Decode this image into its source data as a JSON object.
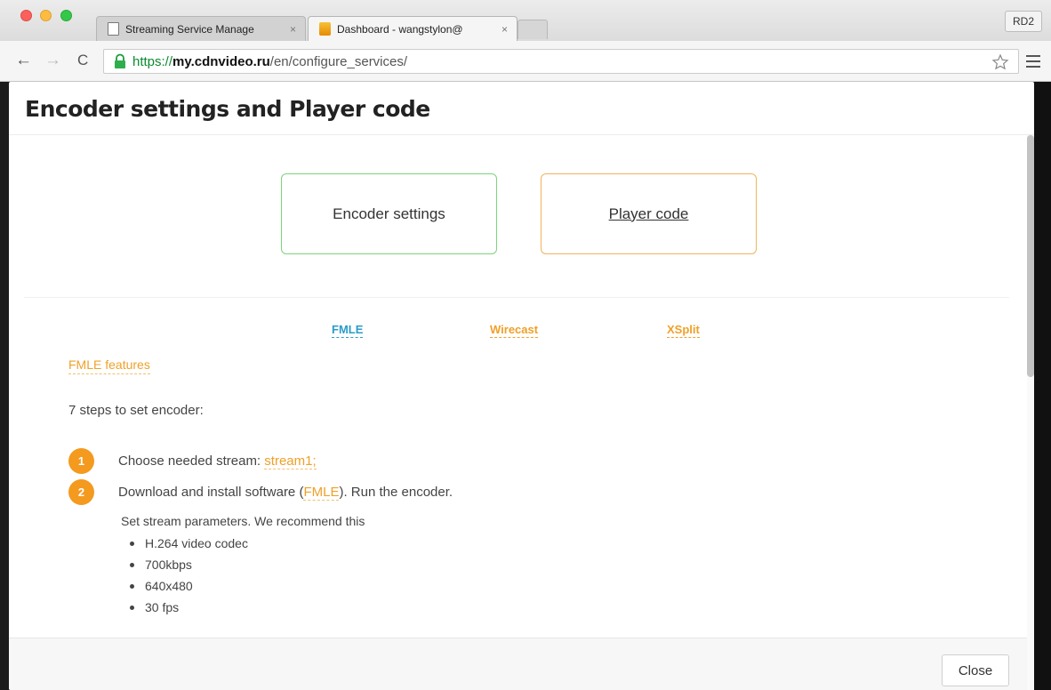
{
  "browser": {
    "tabs": [
      {
        "title": "Streaming Service Manage",
        "close": "×"
      },
      {
        "title": "Dashboard - wangstylon@",
        "close": "×"
      }
    ],
    "profile": "RD2",
    "url": {
      "scheme": "https://",
      "host": "my.cdnvideo.ru",
      "path": "/en/configure_services/"
    }
  },
  "modal": {
    "title": "Encoder settings and Player code",
    "cards": {
      "encoder": "Encoder settings",
      "player": "Player code"
    },
    "encoder_tabs": [
      "FMLE",
      "Wirecast",
      "XSplit"
    ],
    "features_link": "FMLE features",
    "steps_heading": "7 steps to set encoder:",
    "step1": {
      "num": "1",
      "text": "Choose needed stream: ",
      "link": "stream1;"
    },
    "step2": {
      "num": "2",
      "text_before": "Download and install software (",
      "link": "FMLE",
      "text_after": "). Run the encoder."
    },
    "params_intro": "Set stream parameters. We recommend this",
    "params": [
      "H.264 video codec",
      "700kbps",
      "640x480",
      "30 fps"
    ],
    "close_label": "Close"
  },
  "colors": {
    "accent_orange": "#f0a028",
    "accent_blue": "#2b9cc8",
    "card_green": "#7dd37b",
    "card_orange": "#f1b45a"
  }
}
